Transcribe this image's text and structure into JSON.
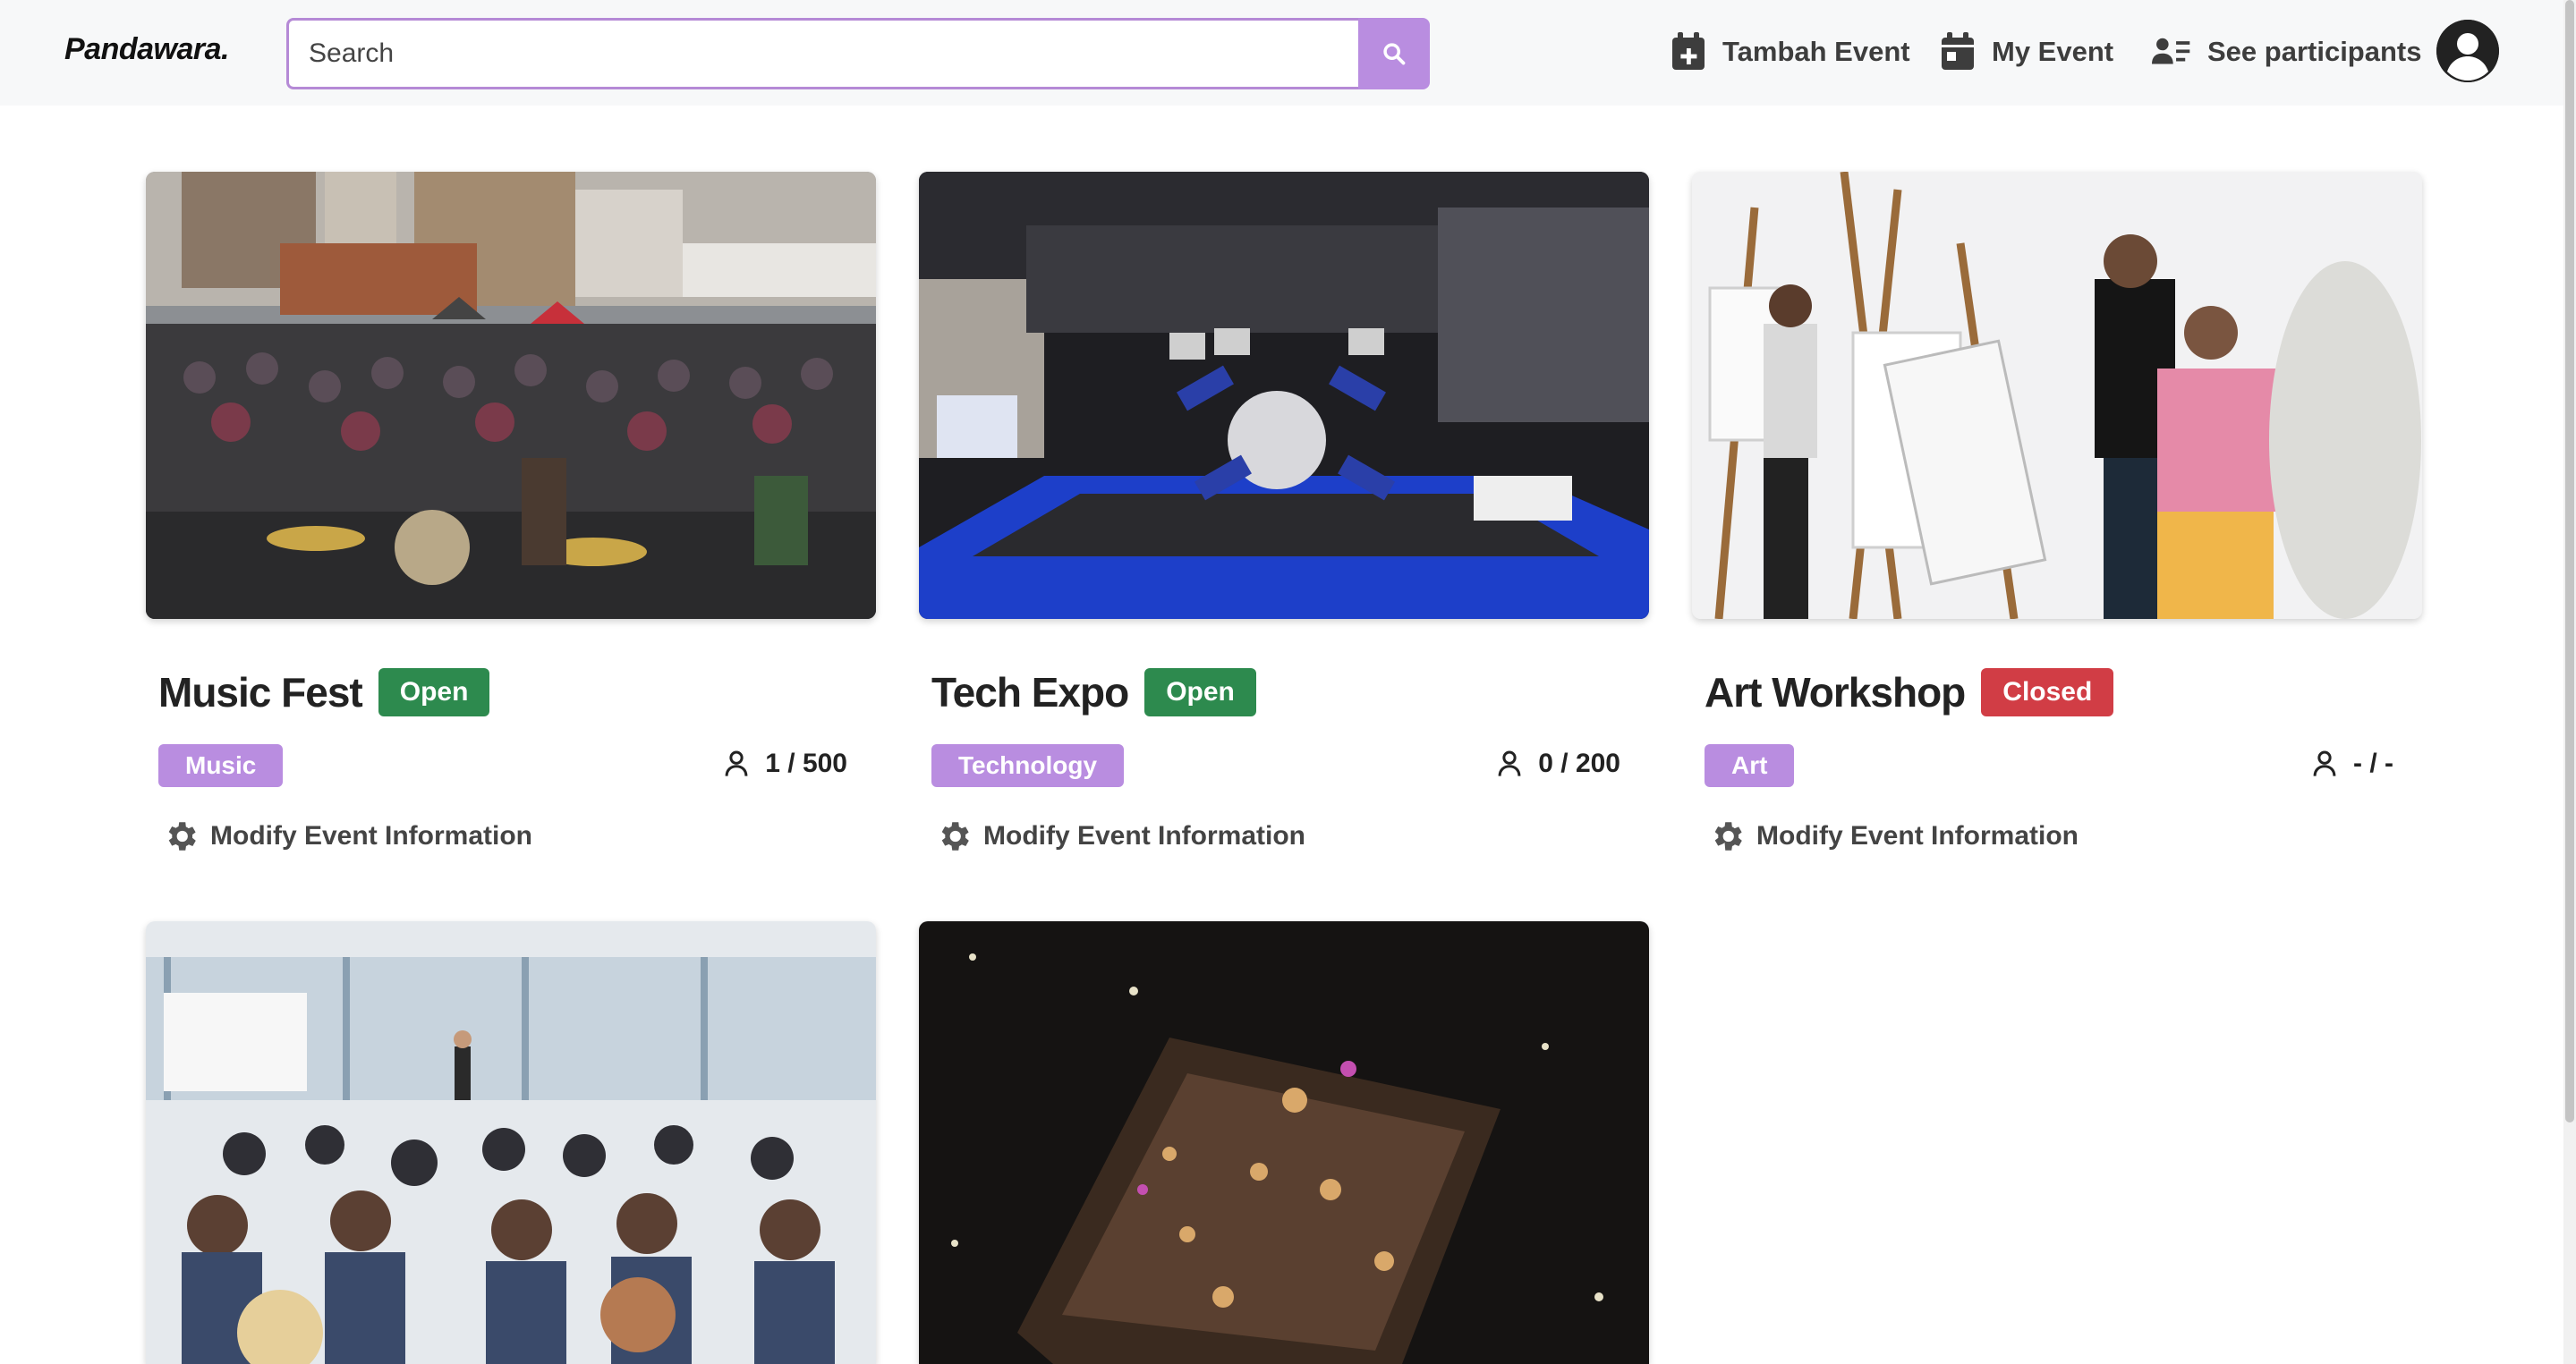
{
  "header": {
    "brand": "Pandawara.",
    "search_placeholder": "Search",
    "nav": [
      {
        "label": "Tambah Event",
        "icon": "calendar-plus-icon"
      },
      {
        "label": "My Event",
        "icon": "calendar-icon"
      },
      {
        "label": "See participants",
        "icon": "user-list-icon"
      }
    ],
    "avatar_icon": "user-circle-icon"
  },
  "events": [
    {
      "title": "Music Fest",
      "status": "Open",
      "category": "Music",
      "participants": "1 / 500",
      "modify_label": "Modify Event Information",
      "image": "concert crowd photo"
    },
    {
      "title": "Tech Expo",
      "status": "Open",
      "category": "Technology",
      "participants": "0 / 200",
      "modify_label": "Modify Event Information",
      "image": "expo booth photo"
    },
    {
      "title": "Art Workshop",
      "status": "Closed",
      "category": "Art",
      "participants": "- / -",
      "modify_label": "Modify Event Information",
      "image": "painting class photo"
    }
  ],
  "colors": {
    "accent": "#b98de0",
    "open": "#2d8a4e",
    "closed": "#d13d45"
  }
}
